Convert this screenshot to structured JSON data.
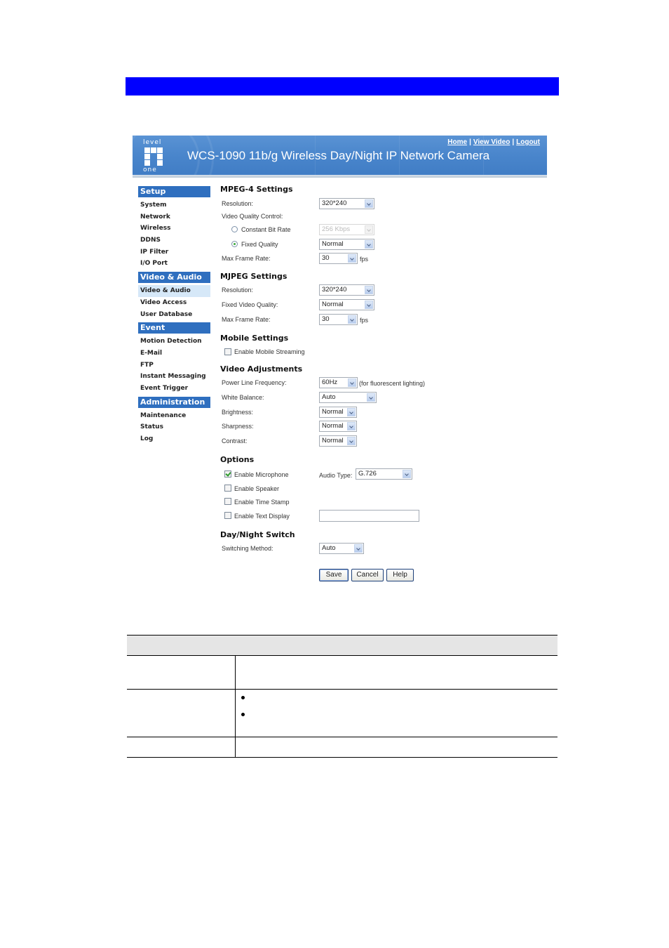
{
  "header": {
    "logo_top": "level",
    "logo_bottom": "one",
    "title": "WCS-1090 11b/g Wireless Day/Night IP Network Camera",
    "links": [
      {
        "label": "Home"
      },
      {
        "label": "View Video"
      },
      {
        "label": "Logout"
      }
    ],
    "separator": "|"
  },
  "sidebar": {
    "sections": [
      {
        "title": "Setup",
        "items": [
          "System",
          "Network",
          "Wireless",
          "DDNS",
          "IP Filter",
          "I/O Port"
        ]
      },
      {
        "title": "Video & Audio",
        "items": [
          "Video & Audio",
          "Video Access",
          "User Database"
        ],
        "active_item": "Video & Audio"
      },
      {
        "title": "Event",
        "items": [
          "Motion Detection",
          "E-Mail",
          "FTP",
          "Instant Messaging",
          "Event Trigger"
        ]
      },
      {
        "title": "Administration",
        "items": [
          "Maintenance",
          "Status",
          "Log"
        ]
      }
    ]
  },
  "mpeg4": {
    "heading": "MPEG-4 Settings",
    "resolution_label": "Resolution:",
    "resolution_value": "320*240",
    "vqc_label": "Video Quality Control:",
    "cbr_label": "Constant Bit Rate",
    "cbr_value": "256 Kbps",
    "cbr_selected": false,
    "fixed_label": "Fixed Quality",
    "fixed_value": "Normal",
    "fixed_selected": true,
    "framerate_label": "Max Frame Rate:",
    "framerate_value": "30",
    "fps_unit": "fps"
  },
  "mjpeg": {
    "heading": "MJPEG Settings",
    "resolution_label": "Resolution:",
    "resolution_value": "320*240",
    "quality_label": "Fixed Video Quality:",
    "quality_value": "Normal",
    "framerate_label": "Max Frame Rate:",
    "framerate_value": "30",
    "fps_unit": "fps"
  },
  "mobile": {
    "heading": "Mobile Settings",
    "enable_label": "Enable Mobile Streaming",
    "enabled": false
  },
  "adjust": {
    "heading": "Video Adjustments",
    "power_label": "Power Line Frequency:",
    "power_value": "60Hz",
    "power_note": "(for fluorescent lighting)",
    "wb_label": "White Balance:",
    "wb_value": "Auto",
    "brightness_label": "Brightness:",
    "brightness_value": "Normal",
    "sharpness_label": "Sharpness:",
    "sharpness_value": "Normal",
    "contrast_label": "Contrast:",
    "contrast_value": "Normal"
  },
  "options": {
    "heading": "Options",
    "microphone_label": "Enable Microphone",
    "microphone": true,
    "audio_type_label": "Audio Type:",
    "audio_type_value": "G.726",
    "speaker_label": "Enable Speaker",
    "speaker": false,
    "timestamp_label": "Enable Time Stamp",
    "timestamp": false,
    "textdisplay_label": "Enable Text Display",
    "textdisplay": false,
    "text_value": ""
  },
  "daynight": {
    "heading": "Day/Night Switch",
    "method_label": "Switching Method:",
    "method_value": "Auto"
  },
  "buttons": {
    "save": "Save",
    "cancel": "Cancel",
    "help": "Help"
  },
  "colors": {
    "top_bar": "#0000ff",
    "sidebar_section": "#2f6fbf",
    "sidebar_active": "#d6e8f8",
    "table_header": "#e5e5e5"
  }
}
